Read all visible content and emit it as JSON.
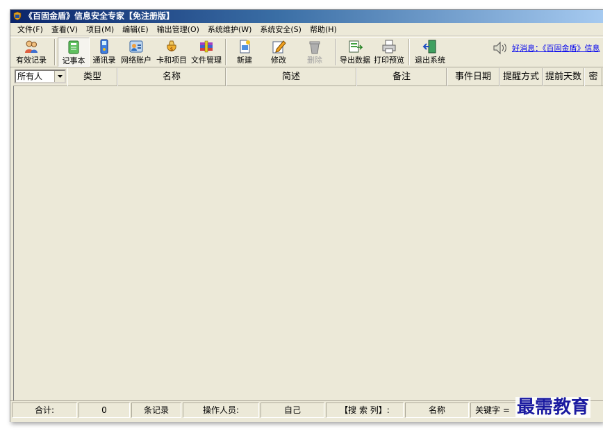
{
  "window": {
    "title": "《百固金盾》信息安全专家【免注册版】"
  },
  "menu": [
    {
      "label": "文件(F)"
    },
    {
      "label": "查看(V)"
    },
    {
      "label": "项目(M)"
    },
    {
      "label": "编辑(E)"
    },
    {
      "label": "输出管理(O)"
    },
    {
      "label": "系统维护(W)"
    },
    {
      "label": "系统安全(S)"
    },
    {
      "label": "帮助(H)"
    }
  ],
  "toolbar": {
    "buttons": [
      {
        "label": "有效记录",
        "icon": "people-icon"
      },
      {
        "label": "记事本",
        "icon": "notebook-icon"
      },
      {
        "label": "通讯录",
        "icon": "phone-icon"
      },
      {
        "label": "网络账户",
        "icon": "network-account-icon"
      },
      {
        "label": "卡和项目",
        "icon": "card-bag-icon"
      },
      {
        "label": "文件管理",
        "icon": "file-archive-icon"
      },
      {
        "label": "新建",
        "icon": "new-document-icon"
      },
      {
        "label": "修改",
        "icon": "edit-icon"
      },
      {
        "label": "删除",
        "icon": "trash-icon"
      },
      {
        "label": "导出数据",
        "icon": "export-icon"
      },
      {
        "label": "打印预览",
        "icon": "printer-icon"
      },
      {
        "label": "退出系统",
        "icon": "exit-door-icon"
      }
    ],
    "news_link": "好消息：《百固金盾》信息"
  },
  "grid": {
    "owner_filter": "所有人",
    "columns": [
      "类型",
      "名称",
      "简述",
      "备注",
      "事件日期",
      "提醒方式",
      "提前天数",
      "密"
    ]
  },
  "status": {
    "total_label": "合计:",
    "total_value": "0",
    "records_label": "条记录",
    "operator_label": "操作人员:",
    "operator_value": "自己",
    "search_col_label": "【搜 索 列】:",
    "search_col_value": "名称",
    "keyword_label": "关键字 ="
  },
  "watermark": "最需教育",
  "colors": {
    "accent": "#0a246a",
    "face": "#ece9d8"
  }
}
